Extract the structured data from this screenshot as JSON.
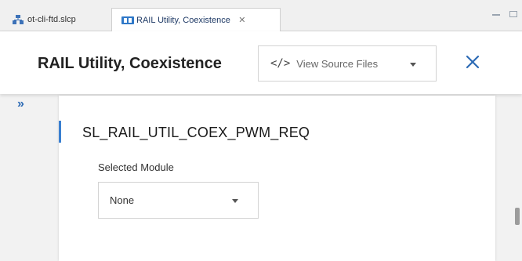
{
  "tabs": [
    {
      "label": "ot-cli-ftd.slcp",
      "active": false,
      "icon": "project-icon"
    },
    {
      "label": "RAIL Utility, Coexistence",
      "active": true,
      "icon": "component-icon",
      "close_glyph": "✕"
    }
  ],
  "header": {
    "title": "RAIL Utility, Coexistence",
    "source_button": {
      "icon_glyph": "</>",
      "label": "View Source Files"
    },
    "close_glyph": "✕"
  },
  "sidebar": {
    "expand_glyph": "»"
  },
  "section": {
    "title": "SL_RAIL_UTIL_COEX_PWM_REQ",
    "field_label": "Selected Module",
    "selected_value": "None"
  },
  "colors": {
    "accent": "#3a7fd0",
    "title": "#222222",
    "close": "#2d6bb5"
  }
}
